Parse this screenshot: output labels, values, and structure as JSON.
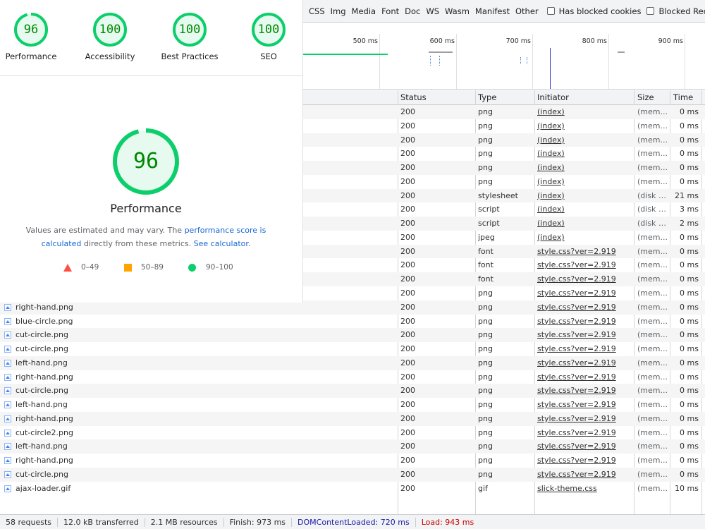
{
  "filter_bar": {
    "types": [
      "CSS",
      "Img",
      "Media",
      "Font",
      "Doc",
      "WS",
      "Wasm",
      "Manifest",
      "Other"
    ],
    "blocked_cookies_label": "Has blocked cookies",
    "blocked_requests_label": "Blocked Requests"
  },
  "overview": {
    "ticks": [
      "500 ms",
      "600 ms",
      "700 ms",
      "800 ms",
      "900 ms"
    ]
  },
  "table": {
    "columns": {
      "status": "Status",
      "type": "Type",
      "initiator": "Initiator",
      "size": "Size",
      "time": "Time"
    },
    "rows": [
      {
        "name": "",
        "icon": "",
        "status": "200",
        "type": "png",
        "initiator": "(index)",
        "size": "(mem...",
        "time": "0 ms"
      },
      {
        "name": "",
        "icon": "",
        "status": "200",
        "type": "png",
        "initiator": "(index)",
        "size": "(mem...",
        "time": "0 ms"
      },
      {
        "name": "",
        "icon": "",
        "status": "200",
        "type": "png",
        "initiator": "(index)",
        "size": "(mem...",
        "time": "0 ms"
      },
      {
        "name": "",
        "icon": "",
        "status": "200",
        "type": "png",
        "initiator": "(index)",
        "size": "(mem...",
        "time": "0 ms"
      },
      {
        "name": "",
        "icon": "",
        "status": "200",
        "type": "png",
        "initiator": "(index)",
        "size": "(mem...",
        "time": "0 ms"
      },
      {
        "name": "",
        "icon": "",
        "status": "200",
        "type": "png",
        "initiator": "(index)",
        "size": "(mem...",
        "time": "0 ms"
      },
      {
        "name": "",
        "icon": "",
        "status": "200",
        "type": "stylesheet",
        "initiator": "(index)",
        "size": "(disk c...",
        "time": "21 ms"
      },
      {
        "name": "",
        "icon": "",
        "status": "200",
        "type": "script",
        "initiator": "(index)",
        "size": "(disk c...",
        "time": "3 ms"
      },
      {
        "name": "",
        "icon": "",
        "status": "200",
        "type": "script",
        "initiator": "(index)",
        "size": "(disk c...",
        "time": "2 ms"
      },
      {
        "name": "",
        "icon": "",
        "status": "200",
        "type": "jpeg",
        "initiator": "(index)",
        "size": "(mem...",
        "time": "0 ms"
      },
      {
        "name": "",
        "icon": "",
        "status": "200",
        "type": "font",
        "initiator": "style.css?ver=2.919",
        "size": "(mem...",
        "time": "0 ms"
      },
      {
        "name": "",
        "icon": "",
        "status": "200",
        "type": "font",
        "initiator": "style.css?ver=2.919",
        "size": "(mem...",
        "time": "0 ms"
      },
      {
        "name": "",
        "icon": "",
        "status": "200",
        "type": "font",
        "initiator": "style.css?ver=2.919",
        "size": "(mem...",
        "time": "0 ms"
      },
      {
        "name": "",
        "icon": "",
        "status": "200",
        "type": "png",
        "initiator": "style.css?ver=2.919",
        "size": "(mem...",
        "time": "0 ms"
      },
      {
        "name": "right-hand.png",
        "icon": "image-icon",
        "status": "200",
        "type": "png",
        "initiator": "style.css?ver=2.919",
        "size": "(mem...",
        "time": "0 ms"
      },
      {
        "name": "blue-circle.png",
        "icon": "image-icon",
        "status": "200",
        "type": "png",
        "initiator": "style.css?ver=2.919",
        "size": "(mem...",
        "time": "0 ms"
      },
      {
        "name": "cut-circle.png",
        "icon": "image-icon",
        "status": "200",
        "type": "png",
        "initiator": "style.css?ver=2.919",
        "size": "(mem...",
        "time": "0 ms"
      },
      {
        "name": "cut-circle.png",
        "icon": "image-icon",
        "status": "200",
        "type": "png",
        "initiator": "style.css?ver=2.919",
        "size": "(mem...",
        "time": "0 ms"
      },
      {
        "name": "left-hand.png",
        "icon": "image-icon",
        "status": "200",
        "type": "png",
        "initiator": "style.css?ver=2.919",
        "size": "(mem...",
        "time": "0 ms"
      },
      {
        "name": "right-hand.png",
        "icon": "image-icon",
        "status": "200",
        "type": "png",
        "initiator": "style.css?ver=2.919",
        "size": "(mem...",
        "time": "0 ms"
      },
      {
        "name": "cut-circle.png",
        "icon": "image-icon",
        "status": "200",
        "type": "png",
        "initiator": "style.css?ver=2.919",
        "size": "(mem...",
        "time": "0 ms"
      },
      {
        "name": "left-hand.png",
        "icon": "image-icon",
        "status": "200",
        "type": "png",
        "initiator": "style.css?ver=2.919",
        "size": "(mem...",
        "time": "0 ms"
      },
      {
        "name": "right-hand.png",
        "icon": "image-icon",
        "status": "200",
        "type": "png",
        "initiator": "style.css?ver=2.919",
        "size": "(mem...",
        "time": "0 ms"
      },
      {
        "name": "cut-circle2.png",
        "icon": "image-icon",
        "status": "200",
        "type": "png",
        "initiator": "style.css?ver=2.919",
        "size": "(mem...",
        "time": "0 ms"
      },
      {
        "name": "left-hand.png",
        "icon": "image-icon",
        "status": "200",
        "type": "png",
        "initiator": "style.css?ver=2.919",
        "size": "(mem...",
        "time": "0 ms"
      },
      {
        "name": "right-hand.png",
        "icon": "image-icon",
        "status": "200",
        "type": "png",
        "initiator": "style.css?ver=2.919",
        "size": "(mem...",
        "time": "0 ms"
      },
      {
        "name": "cut-circle.png",
        "icon": "image-icon",
        "status": "200",
        "type": "png",
        "initiator": "style.css?ver=2.919",
        "size": "(mem...",
        "time": "0 ms"
      },
      {
        "name": "ajax-loader.gif",
        "icon": "image-icon",
        "status": "200",
        "type": "gif",
        "initiator": "slick-theme.css",
        "size": "(mem...",
        "time": "10 ms"
      }
    ]
  },
  "status_bar": {
    "requests": "58 requests",
    "transferred": "12.0 kB transferred",
    "resources": "2.1 MB resources",
    "finish": "Finish: 973 ms",
    "dom_content_loaded": "DOMContentLoaded: 720 ms",
    "load": "Load: 943 ms",
    "dom_color": "#1a1aa6",
    "load_color": "#c80000"
  },
  "lighthouse": {
    "gauges": [
      {
        "score": "96",
        "label": "Performance",
        "fraction": 0.96
      },
      {
        "score": "100",
        "label": "Accessibility",
        "fraction": 1.0
      },
      {
        "score": "100",
        "label": "Best Practices",
        "fraction": 1.0
      },
      {
        "score": "100",
        "label": "SEO",
        "fraction": 1.0
      }
    ],
    "main_score": "96",
    "main_fraction": 0.96,
    "main_title": "Performance",
    "desc_prefix": "Values are estimated and may vary. The ",
    "desc_link1": "performance score is calculated",
    "desc_middle": " directly from these metrics. ",
    "desc_link2": "See calculator",
    "desc_suffix": ".",
    "legend": {
      "fail": "0–49",
      "average": "50–89",
      "pass": "90–100"
    },
    "colors": {
      "pass": "#0cce6b",
      "pass_text": "#008800",
      "average": "#ffa400",
      "fail": "#ff4e42",
      "pass_bg": "#e6faef"
    }
  }
}
